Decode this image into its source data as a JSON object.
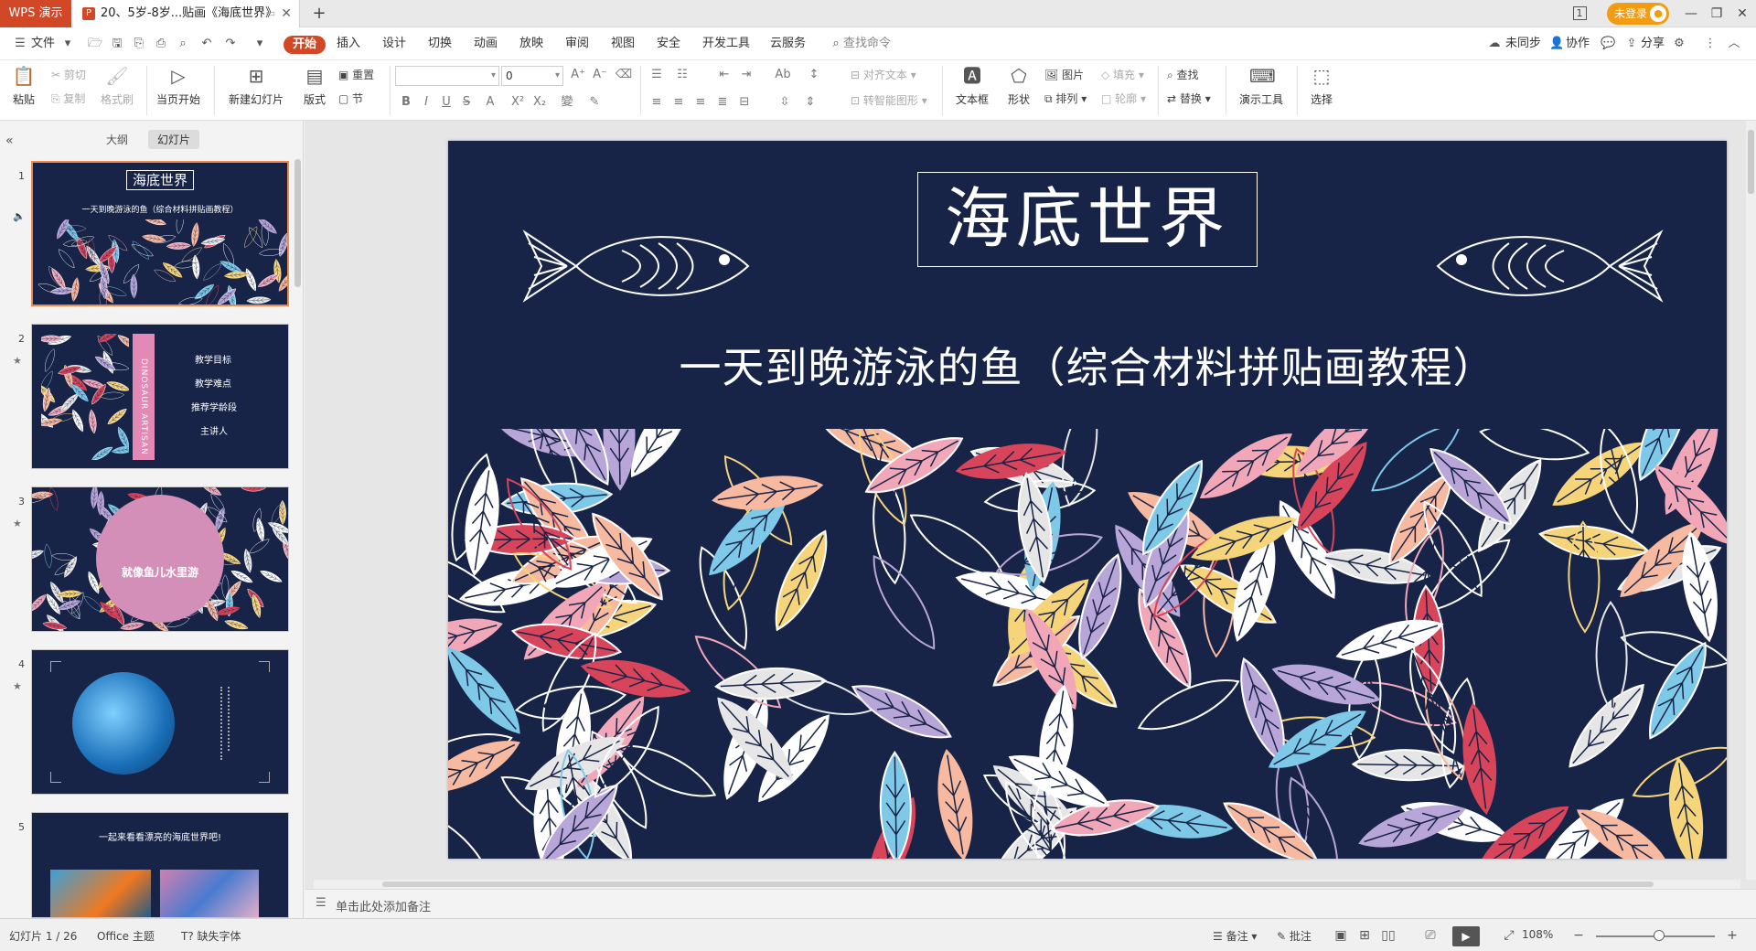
{
  "titlebar": {
    "app_tab": "WPS 演示",
    "doc_tab": "20、5岁-8岁...贴画《海底世界》",
    "doc_icon": "P",
    "new_tab": "+",
    "login": "未登录",
    "page_badge": "1"
  },
  "menu": {
    "file": "文件",
    "items": [
      "开始",
      "插入",
      "设计",
      "切换",
      "动画",
      "放映",
      "审阅",
      "视图",
      "安全",
      "开发工具",
      "云服务"
    ],
    "search": "查找命令",
    "right": [
      "未同步",
      "协作",
      "分享"
    ]
  },
  "ribbon": {
    "paste": "粘贴",
    "cut": "剪切",
    "copy": "复制",
    "format_painter": "格式刷",
    "from_start": "当页开始",
    "new_slide": "新建幻灯片",
    "layout": "版式",
    "reset": "重置",
    "section": "节",
    "font_size": "0",
    "align_text": "对齐文本",
    "smart_shape": "转智能图形",
    "textbox": "文本框",
    "shape": "形状",
    "picture": "图片",
    "arrange": "排列",
    "fill": "填充",
    "outline": "轮廓",
    "find": "查找",
    "replace": "替换",
    "presenter_tools": "演示工具",
    "select": "选择"
  },
  "panel": {
    "tab_outline": "大纲",
    "tab_slides": "幻灯片",
    "thumbs": [
      {
        "num": "1",
        "title": "海底世界",
        "sub": "一天到晚游泳的鱼（综合材料拼贴画教程）"
      },
      {
        "num": "2",
        "side": "DINOSAUR ARTISAN",
        "lines": [
          "教学目标",
          "教学难点",
          "推荐学龄段",
          "主讲人"
        ]
      },
      {
        "num": "3",
        "circle": "就像鱼儿水里游"
      },
      {
        "num": "4"
      },
      {
        "num": "5",
        "title": "一起来看看漂亮的海底世界吧!"
      }
    ]
  },
  "slide": {
    "title": "海底世界",
    "subtitle": "一天到晚游泳的鱼（综合材料拼贴画教程）"
  },
  "notes": {
    "placeholder": "单击此处添加备注"
  },
  "status": {
    "slide_counter": "幻灯片 1 / 26",
    "theme": "Office 主题",
    "missing_font": "缺失字体",
    "notes": "备注",
    "comments": "批注",
    "zoom": "108%"
  },
  "colors": {
    "accent": "#d24726",
    "slide_bg": "#172447",
    "login": "#f39c12"
  }
}
